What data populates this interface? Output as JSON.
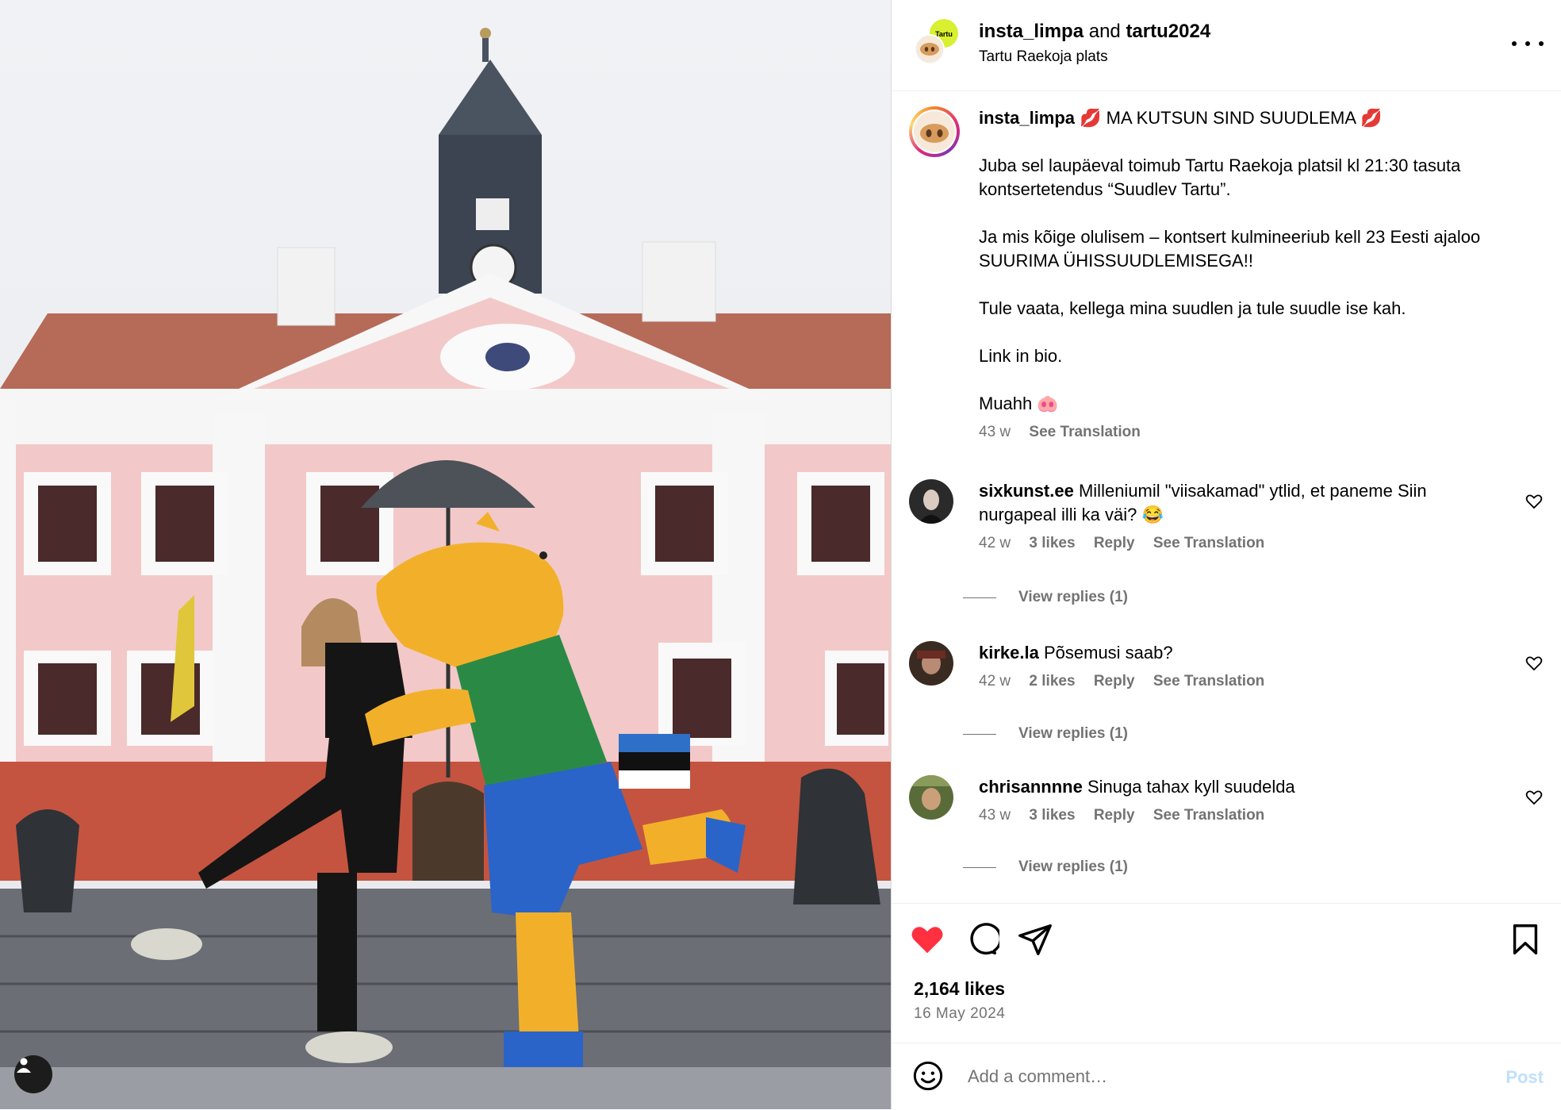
{
  "colors": {
    "like_red": "#ff3040",
    "link_blue": "#0095f6",
    "post_disabled": "#c0dffd",
    "muted": "#737373"
  },
  "header": {
    "author": "insta_limpa",
    "conjunction": "and",
    "collaborator": "tartu2024",
    "location": "Tartu Raekoja plats",
    "collab_badge": "Tartu 2024",
    "more_icon": "more-horizontal-icon"
  },
  "caption": {
    "username": "insta_limpa",
    "headline": "💋 MA KUTSUN SIND SUUDLEMA 💋",
    "paragraphs": [
      "Juba sel laupäeval toimub Tartu Raekoja platsil kl 21:30 tasuta kontsertetendus “Suudlev Tartu”.",
      "Ja mis kõige olulisem – kontsert kulmineeriub kell 23 Eesti ajaloo SUURIMA ÜHISSUUDLEMISEGA!!",
      "Tule vaata, kellega mina suudlen ja tule suudle ise kah.",
      "Link in bio."
    ],
    "signoff": "Muahh 🐽",
    "time": "43 w",
    "translate": "See Translation"
  },
  "comments": [
    {
      "username": "sixkunst.ee",
      "text": "Milleniumil \"viisakamad\" ytlid, et paneme Siin nurgapeal illi ka väi? 😂",
      "time": "42 w",
      "likes": "3 likes",
      "reply": "Reply",
      "translate": "See Translation",
      "view_replies": "View replies (1)"
    },
    {
      "username": "kirke.la",
      "text": "Põsemusi saab?",
      "time": "42 w",
      "likes": "2 likes",
      "reply": "Reply",
      "translate": "See Translation",
      "view_replies": "View replies (1)"
    },
    {
      "username": "chrisannnne",
      "text": "Sinuga tahax kyll suudelda",
      "time": "43 w",
      "likes": "3 likes",
      "reply": "Reply",
      "translate": "See Translation",
      "view_replies": "View replies (1)"
    }
  ],
  "actions": {
    "liked": true,
    "likes": "2,164 likes",
    "date": "16 May 2024"
  },
  "composer": {
    "placeholder": "Add a comment…",
    "post_label": "Post"
  }
}
